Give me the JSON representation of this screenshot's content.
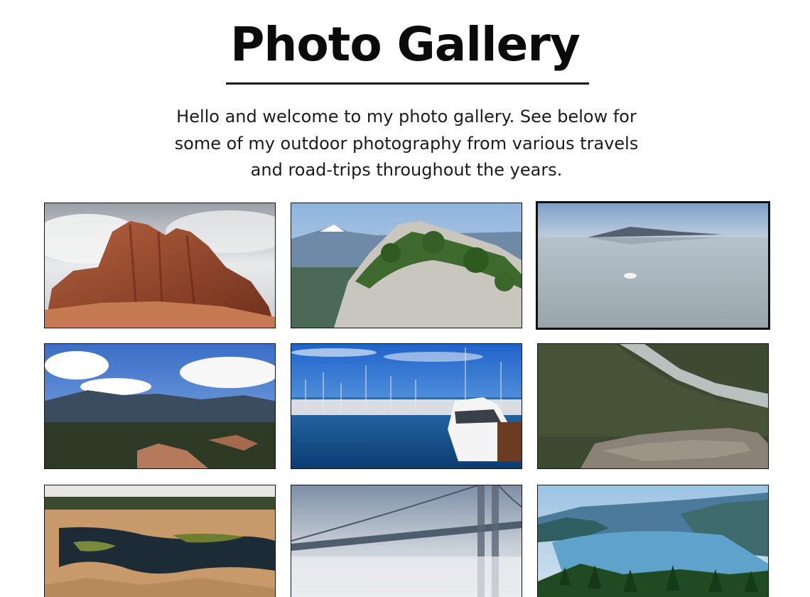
{
  "header": {
    "title": "Photo Gallery"
  },
  "intro": {
    "text": "Hello and welcome to my photo gallery. See below for some of my outdoor photography from various travels and road-trips throughout the years."
  },
  "gallery": {
    "selected_index": 2,
    "photos": [
      {
        "subject": "red-rock-formation"
      },
      {
        "subject": "granite-cliff-with-trees"
      },
      {
        "subject": "salt-flats-reflection"
      },
      {
        "subject": "mountains-blue-sky"
      },
      {
        "subject": "marina-sailboats"
      },
      {
        "subject": "river-valley-forest"
      },
      {
        "subject": "rock-pools-wetland"
      },
      {
        "subject": "bridge-in-fog"
      },
      {
        "subject": "lake-fjord-mountains"
      }
    ]
  }
}
